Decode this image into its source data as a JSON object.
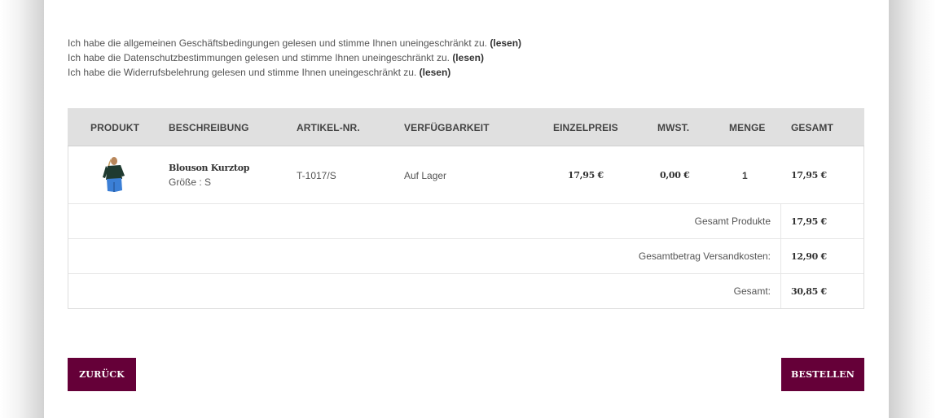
{
  "agreements": [
    {
      "text": "Ich habe die allgemeinen Geschäftsbedingungen gelesen und stimme Ihnen uneingeschränkt zu.",
      "link": "(lesen)"
    },
    {
      "text": "Ich habe die Datenschutzbestimmungen gelesen und stimme Ihnen uneingeschränkt zu.",
      "link": "(lesen)"
    },
    {
      "text": "Ich habe die Widerrufsbelehrung gelesen und stimme Ihnen uneingeschränkt zu.",
      "link": "(lesen)"
    }
  ],
  "table": {
    "headers": {
      "product": "PRODUKT",
      "description": "BESCHREIBUNG",
      "article_no": "ARTIKEL-NR.",
      "availability": "VERFÜGBARKEIT",
      "unit_price": "EINZELPREIS",
      "vat": "MWST.",
      "quantity": "MENGE",
      "total": "GESAMT"
    },
    "items": [
      {
        "name": "Blouson Kurztop",
        "size_label": "Größe : S",
        "article_no": "T-1017/S",
        "availability": "Auf Lager",
        "unit_price": "17,95 €",
        "vat": "0,00 €",
        "quantity": "1",
        "total": "17,95 €"
      }
    ],
    "summary": {
      "products_label": "Gesamt Produkte",
      "products_value": "17,95 €",
      "shipping_label": "Gesamtbetrag Versandkosten:",
      "shipping_value": "12,90 €",
      "grand_label": "Gesamt:",
      "grand_value": "30,85 €"
    }
  },
  "buttons": {
    "back": "ZURÜCK",
    "order": "BESTELLEN"
  },
  "colors": {
    "accent": "#650038",
    "header_bg": "#e0e0e0"
  }
}
